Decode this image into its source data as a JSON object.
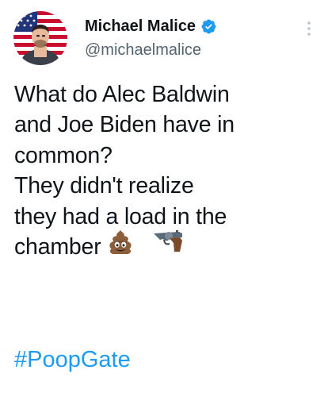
{
  "tweet": {
    "author": {
      "display_name": "Michael Malice",
      "handle": "@michaelmalice",
      "verified": true,
      "avatar_icon": "profile-photo-flag-background"
    },
    "more_icon": "vertical-ellipsis-icon",
    "text_lines": [
      "What do Alec Baldwin",
      "and Joe Biden have in",
      "common?",
      "They didn't realize",
      "they had a load in the",
      "chamber"
    ],
    "emojis": [
      "pile-of-poo",
      "pistol"
    ],
    "hashtag": "#PoopGate"
  },
  "colors": {
    "text": "#0f1419",
    "secondary_text": "#536471",
    "link": "#1d9bf0",
    "verified_badge": "#1d9bf0"
  }
}
